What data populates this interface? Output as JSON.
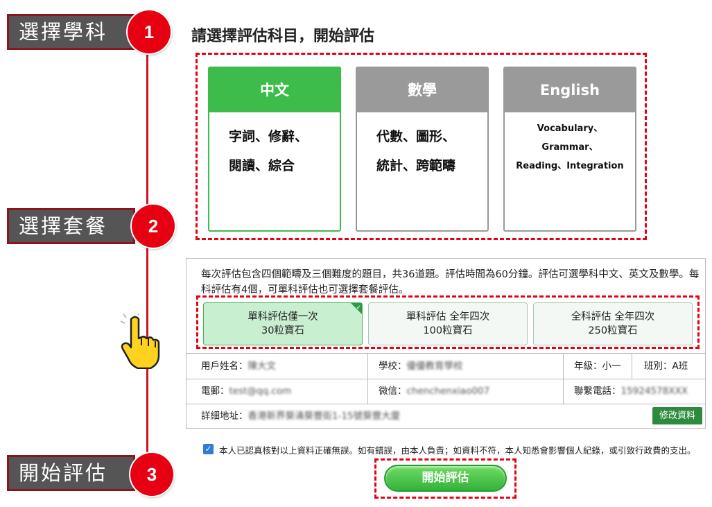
{
  "steps": [
    {
      "label": "選擇學科",
      "number": "1"
    },
    {
      "label": "選擇套餐",
      "number": "2"
    },
    {
      "label": "開始評估",
      "number": "3"
    }
  ],
  "page_title": "請選擇評估科目，開始評估",
  "subjects": [
    {
      "title": "中文",
      "line1": "字詞、修辭、",
      "line2": "閱讀、綜合",
      "selected": true
    },
    {
      "title": "數學",
      "line1": "代數、圖形、",
      "line2": "統計、跨範疇",
      "selected": false
    },
    {
      "title": "English",
      "line1": "Vocabulary、Grammar、",
      "line2": "Reading、Integration",
      "selected": false
    }
  ],
  "description": "每次評估包含四個範疇及三個難度的題目，共36道題。評估時間為60分鐘。評估可選學科中文、英文及數學。每科評估有4個，可單科評估也可選擇套餐評估。",
  "packages": [
    {
      "line1": "單科評估僅一次",
      "line2": "30粒寶石",
      "selected": true
    },
    {
      "line1": "單科評估 全年四次",
      "line2": "100粒寶石",
      "selected": false
    },
    {
      "line1": "全科評估 全年四次",
      "line2": "250粒寶石",
      "selected": false
    }
  ],
  "user_info": {
    "name_label": "用戶姓名：",
    "name_value": "陳大文",
    "school_label": "學校：",
    "school_value": "優優教育學校",
    "grade_label": "年級：",
    "grade_value": "小一",
    "class_label": "班別：",
    "class_value": "A班",
    "email_label": "電郵：",
    "email_value": "test@qq.com",
    "wechat_label": "微信：",
    "wechat_value": "chenchenxiao007",
    "phone_label": "聯繫電話：",
    "phone_value": "15924578XXX",
    "address_label": "詳細地址：",
    "address_value": "香港新界葵涌葵豐街1-15號葵豐大廈",
    "edit_button": "修改資料"
  },
  "consent_text": "本人已認真核對以上資料正確無誤。如有錯誤，由本人負責；如資料不符，本人知悉會影響個人紀錄，或引致行政費的支出。",
  "consent_checked": true,
  "start_button": "開始評估",
  "colors": {
    "accent_red": "#e60012",
    "selected_green": "#3dbb4b",
    "label_gray": "#555555"
  }
}
